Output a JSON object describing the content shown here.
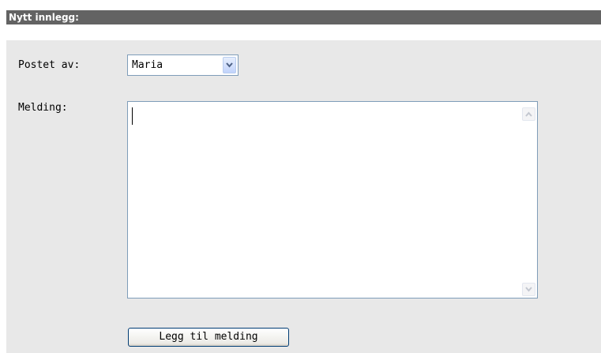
{
  "section": {
    "title": "Nytt innlegg:"
  },
  "form": {
    "author_label": "Postet av:",
    "author_selected": "Maria",
    "message_label": "Melding:",
    "message_value": "",
    "submit_label": "Legg til melding"
  },
  "icons": {
    "select_arrow": "chevron-down-icon",
    "scroll_up": "scroll-up-arrow-icon",
    "scroll_down": "scroll-down-arrow-icon"
  },
  "colors": {
    "header_bar": "#636363",
    "header_text": "#ffffff",
    "panel_background": "#e8e8e8",
    "input_border": "#7f9db9",
    "button_border": "#003c74"
  }
}
